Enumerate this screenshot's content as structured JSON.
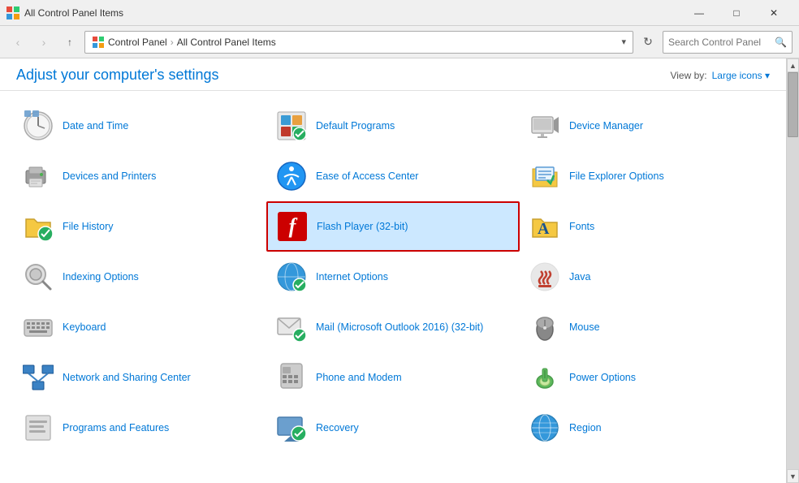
{
  "titleBar": {
    "icon": "🖥",
    "title": "All Control Panel Items",
    "minimize": "—",
    "maximize": "□",
    "close": "✕"
  },
  "addressBar": {
    "back": "‹",
    "forward": "›",
    "up": "↑",
    "parts": [
      "Control Panel",
      "All Control Panel Items"
    ],
    "refresh": "↻",
    "searchPlaceholder": "Search Control Panel"
  },
  "header": {
    "title": "Adjust your computer's settings",
    "viewBy": "View by:",
    "viewMode": "Large icons ▾"
  },
  "items": [
    {
      "id": "date-time",
      "label": "Date and Time",
      "icon": "clock",
      "col": 0,
      "selected": false
    },
    {
      "id": "default-programs",
      "label": "Default Programs",
      "icon": "default",
      "col": 1,
      "selected": false
    },
    {
      "id": "device-manager",
      "label": "Device Manager",
      "icon": "device",
      "col": 2,
      "selected": false
    },
    {
      "id": "devices-printers",
      "label": "Devices and Printers",
      "icon": "printer",
      "col": 0,
      "selected": false
    },
    {
      "id": "ease-of-access",
      "label": "Ease of Access Center",
      "icon": "access",
      "col": 1,
      "selected": false
    },
    {
      "id": "file-explorer",
      "label": "File Explorer Options",
      "icon": "file-exp",
      "col": 2,
      "selected": false
    },
    {
      "id": "file-history",
      "label": "File History",
      "icon": "folder-clock",
      "col": 0,
      "selected": false
    },
    {
      "id": "flash-player",
      "label": "Flash Player (32-bit)",
      "icon": "flash",
      "col": 1,
      "selected": true
    },
    {
      "id": "fonts",
      "label": "Fonts",
      "icon": "fonts",
      "col": 2,
      "selected": false
    },
    {
      "id": "indexing",
      "label": "Indexing Options",
      "icon": "indexing",
      "col": 0,
      "selected": false
    },
    {
      "id": "internet-options",
      "label": "Internet Options",
      "icon": "internet",
      "col": 1,
      "selected": false
    },
    {
      "id": "java",
      "label": "Java",
      "icon": "java",
      "col": 2,
      "selected": false
    },
    {
      "id": "keyboard",
      "label": "Keyboard",
      "icon": "keyboard",
      "col": 0,
      "selected": false
    },
    {
      "id": "mail",
      "label": "Mail (Microsoft Outlook 2016) (32-bit)",
      "icon": "mail",
      "col": 1,
      "selected": false
    },
    {
      "id": "mouse",
      "label": "Mouse",
      "icon": "mouse",
      "col": 2,
      "selected": false
    },
    {
      "id": "network",
      "label": "Network and Sharing Center",
      "icon": "network",
      "col": 0,
      "selected": false
    },
    {
      "id": "phone-modem",
      "label": "Phone and Modem",
      "icon": "phone",
      "col": 1,
      "selected": false
    },
    {
      "id": "power",
      "label": "Power Options",
      "icon": "power",
      "col": 2,
      "selected": false
    },
    {
      "id": "programs",
      "label": "Programs and Features",
      "icon": "programs",
      "col": 0,
      "selected": false
    },
    {
      "id": "recovery",
      "label": "Recovery",
      "icon": "recovery",
      "col": 1,
      "selected": false
    },
    {
      "id": "region",
      "label": "Region",
      "icon": "region",
      "col": 2,
      "selected": false
    }
  ]
}
